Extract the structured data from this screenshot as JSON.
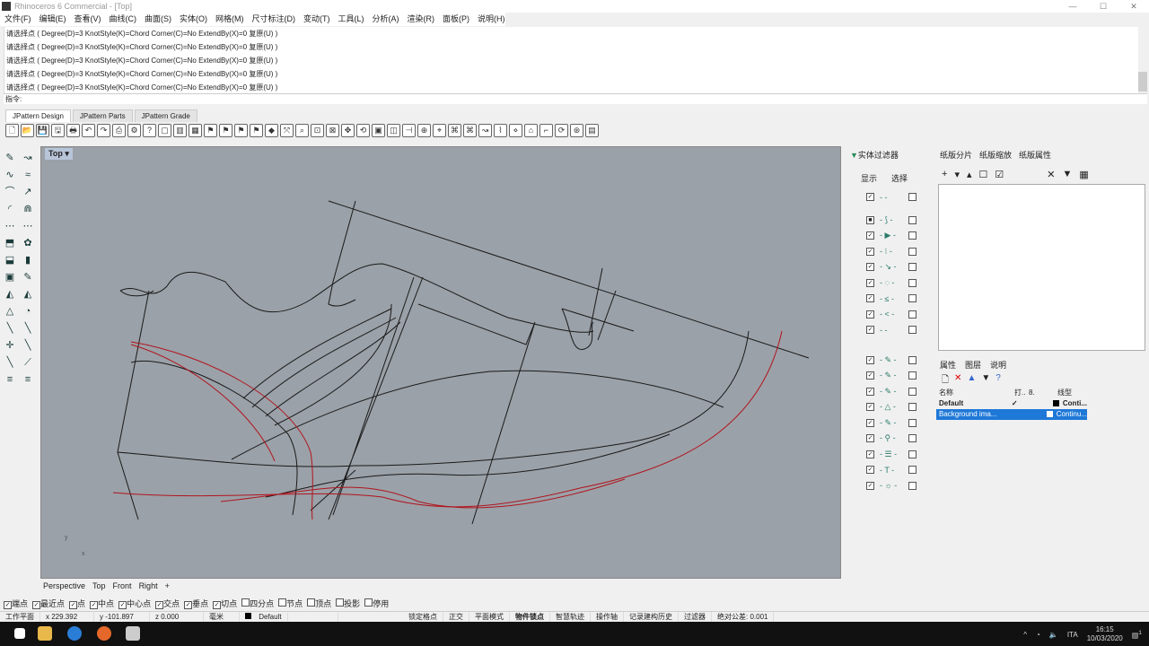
{
  "window": {
    "title": "Rhinoceros 6 Commercial - [Top]",
    "min": "—",
    "max": "☐",
    "close": "✕"
  },
  "menu": [
    "文件(F)",
    "编辑(E)",
    "查看(V)",
    "曲线(C)",
    "曲面(S)",
    "实体(O)",
    "网格(M)",
    "尺寸标注(D)",
    "变动(T)",
    "工具(L)",
    "分析(A)",
    "渲染(R)",
    "面板(P)",
    "说明(H)"
  ],
  "command_history": [
    "请选择点 ( Degree(D)=3  KnotStyle(K)=Chord  Corner(C)=No  ExtendBy(X)=0  复原(U) )",
    "请选择点 ( Degree(D)=3  KnotStyle(K)=Chord  Corner(C)=No  ExtendBy(X)=0  复原(U) )",
    "请选择点 ( Degree(D)=3  KnotStyle(K)=Chord  Corner(C)=No  ExtendBy(X)=0  复原(U) )",
    "请选择点 ( Degree(D)=3  KnotStyle(K)=Chord  Corner(C)=No  ExtendBy(X)=0  复原(U) )",
    "请选择点 ( Degree(D)=3  KnotStyle(K)=Chord  Corner(C)=No  ExtendBy(X)=0  复原(U) )"
  ],
  "command_prompt": "指令:",
  "toolbar_tabs": [
    "JPattern Design",
    "JPattern Parts",
    "JPattern Grade"
  ],
  "viewport": {
    "name": "Top",
    "dropdown": "▾",
    "tabs": [
      "Perspective",
      "Top",
      "Front",
      "Right"
    ],
    "add_tab": "+",
    "axis_y": "y",
    "axis_x": "x"
  },
  "filter_panel": {
    "title": "实体过滤器",
    "col_show": "显示",
    "col_select": "选择"
  },
  "layout_panel": {
    "tabs": [
      "纸版分片",
      "纸版缩放",
      "纸版属性"
    ]
  },
  "props_panel": {
    "tabs": [
      "属性",
      "图层",
      "说明"
    ],
    "columns": [
      "名称",
      "打..",
      "8.",
      "线型"
    ],
    "rows": [
      {
        "name": "Default",
        "current": "✓",
        "linetype": "Conti...",
        "selected": false
      },
      {
        "name": "Background ima...",
        "current": "",
        "linetype": "Continu...",
        "selected": true
      }
    ]
  },
  "osnap": [
    {
      "label": "端点",
      "on": true
    },
    {
      "label": "最近点",
      "on": true
    },
    {
      "label": "点",
      "on": true
    },
    {
      "label": "中点",
      "on": true
    },
    {
      "label": "中心点",
      "on": true
    },
    {
      "label": "交点",
      "on": true
    },
    {
      "label": "垂点",
      "on": true
    },
    {
      "label": "切点",
      "on": true
    },
    {
      "label": "四分点",
      "on": false
    },
    {
      "label": "节点",
      "on": false
    },
    {
      "label": "顶点",
      "on": false
    },
    {
      "label": "投影",
      "on": false
    },
    {
      "label": "停用",
      "on": false
    }
  ],
  "status": {
    "cplane": "工作平面",
    "x": "x 229.392",
    "y": "y -101.897",
    "z": "z 0.000",
    "units": "毫米",
    "layer": "Default",
    "toggles": [
      "锁定格点",
      "正交",
      "平面模式",
      "物件锁点",
      "智慧轨迹",
      "操作轴",
      "记录建构历史",
      "过滤器"
    ],
    "tolerance": "绝对公差: 0.001"
  },
  "taskbar": {
    "lang": "ITA",
    "time": "16:15",
    "date": "10/03/2020",
    "notifications": "1"
  },
  "colors": {
    "viewport": "#9ba1a8",
    "selection": "#1e78d7",
    "curve_red": "#b0141e"
  }
}
